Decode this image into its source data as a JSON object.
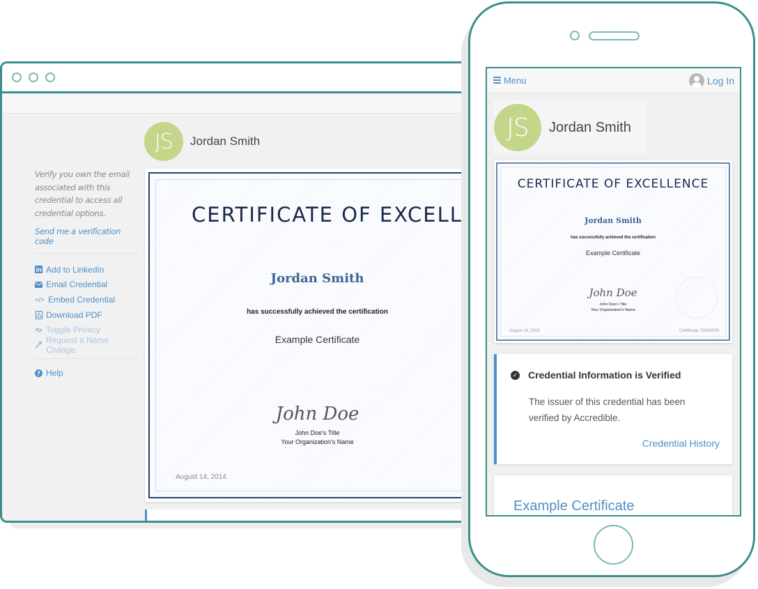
{
  "desktop": {
    "window_controls": [
      "close",
      "minimize",
      "maximize"
    ],
    "profile": {
      "initials": "JS",
      "name": "Jordan Smith"
    },
    "sidebar": {
      "verify_note": "Verify you own the email associated with this credential to access all credential options.",
      "send_code_link": "Send me a verification code",
      "menu_items": [
        {
          "icon": "linkedin-icon",
          "label": "Add to LinkedIn",
          "enabled": true
        },
        {
          "icon": "envelope-icon",
          "label": "Email Credential",
          "enabled": true
        },
        {
          "icon": "code-icon",
          "label": "Embed Credential",
          "enabled": true
        },
        {
          "icon": "pdf-icon",
          "label": "Download PDF",
          "enabled": true
        },
        {
          "icon": "eye-slash-icon",
          "label": "Toggle Privacy",
          "enabled": false
        },
        {
          "icon": "wrench-icon",
          "label": "Request a Name Change",
          "enabled": false
        }
      ],
      "help_label": "Help"
    },
    "certificate": {
      "title": "CERTIFICATE OF EXCELLE",
      "recipient": "Jordan Smith",
      "achieved_text": "has successfully achieved the certification",
      "course": "Example Certificate",
      "signature": "John Doe",
      "signer_title": "John Doe's Title",
      "organization": "Your Organization's Name",
      "date": "August 14, 2014"
    }
  },
  "mobile": {
    "nav": {
      "menu_label": "Menu",
      "login_label": "Log In"
    },
    "profile": {
      "initials": "JS",
      "name": "Jordan Smith"
    },
    "certificate": {
      "title": "CERTIFICATE OF EXCELLENCE",
      "recipient": "Jordan Smith",
      "achieved_text": "has successfully achieved the certification",
      "course": "Example Certificate",
      "signature": "John Doe",
      "signer_title": "John Doe's Title",
      "organization": "Your Organization's Name",
      "date": "August 14, 2014",
      "certificate_number": "Certificate: 10000005"
    },
    "verification": {
      "title": "Credential Information is Verified",
      "text": "The issuer of this credential has been verified by Accredible.",
      "history_link": "Credential History"
    },
    "course_card": {
      "title": "Example Certificate"
    }
  },
  "colors": {
    "frame": "#3a8f8c",
    "frame_light": "#7bb8b6",
    "link": "#4f8fc6",
    "avatar": "#c4d68a",
    "cert_title": "#18284a",
    "cert_recipient": "#3e6493"
  }
}
